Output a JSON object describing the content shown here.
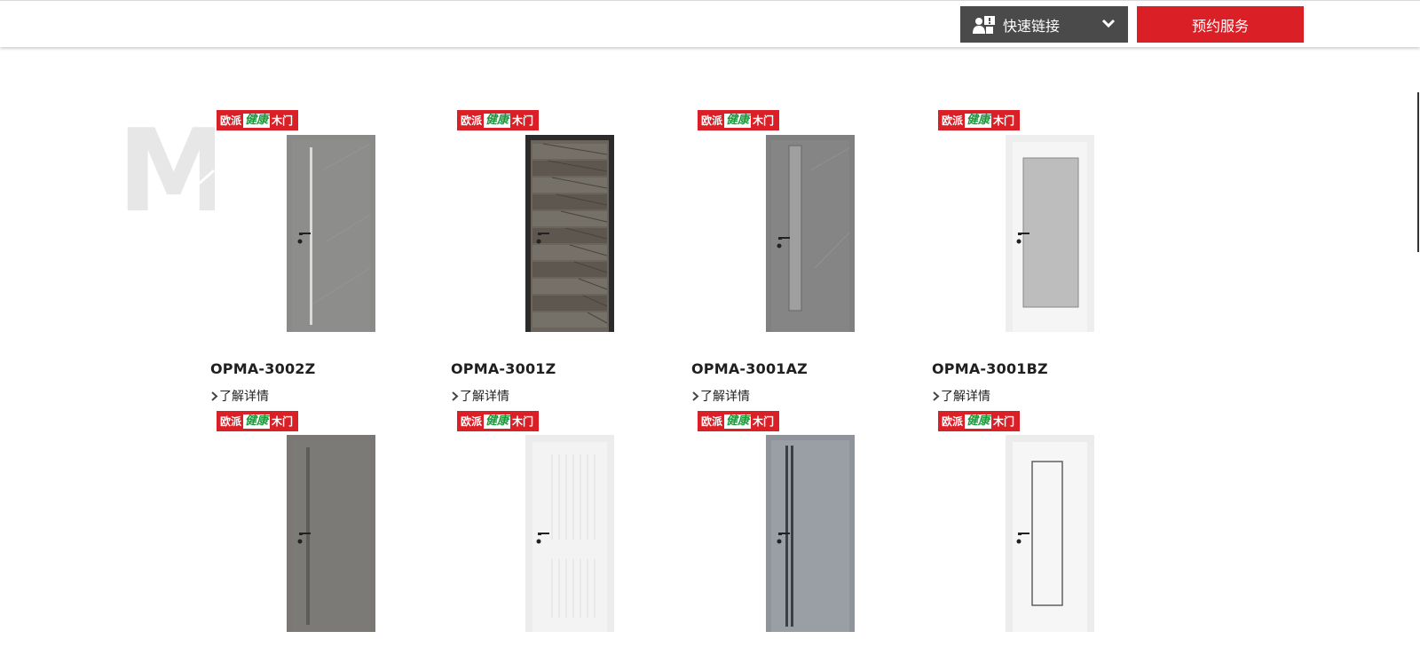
{
  "header": {
    "quick_links_label": "快速链接",
    "book_service_label": "预约服务"
  },
  "watermark_letter": "M",
  "badge": {
    "left": "欧派",
    "middle": "健康",
    "right": "木门"
  },
  "products": [
    {
      "model": "OPMA-3002Z",
      "detail_label": "了解详情",
      "door_style": "gray-stone-strip",
      "frame_color": "#8a8a88",
      "panel_color": "#8d8e8c"
    },
    {
      "model": "OPMA-3001Z",
      "detail_label": "了解详情",
      "door_style": "dark-wood-stripes",
      "frame_color": "#2b2b2b",
      "panel_color": "#6b645d"
    },
    {
      "model": "OPMA-3001AZ",
      "detail_label": "了解详情",
      "door_style": "gray-stone-glass-slot",
      "frame_color": "#808080",
      "panel_color": "#858585"
    },
    {
      "model": "OPMA-3001BZ",
      "detail_label": "了解详情",
      "door_style": "white-glass-panel",
      "frame_color": "#eeeeee",
      "panel_color": "#f5f5f5"
    },
    {
      "model": "",
      "detail_label": "",
      "door_style": "dark-gray-strip",
      "frame_color": "#7a7774",
      "panel_color": "#7c7a77"
    },
    {
      "model": "",
      "detail_label": "",
      "door_style": "white-grooved",
      "frame_color": "#ececec",
      "panel_color": "#f3f3f3"
    },
    {
      "model": "",
      "detail_label": "",
      "door_style": "blue-gray-double-strip",
      "frame_color": "#8f949b",
      "panel_color": "#9a9fa6"
    },
    {
      "model": "",
      "detail_label": "",
      "door_style": "white-inlay-line",
      "frame_color": "#ececec",
      "panel_color": "#f6f6f6"
    }
  ],
  "colors": {
    "brand_red": "#da1f26",
    "dark_button": "#4a4a4a",
    "badge_green": "#1a9a3a"
  }
}
